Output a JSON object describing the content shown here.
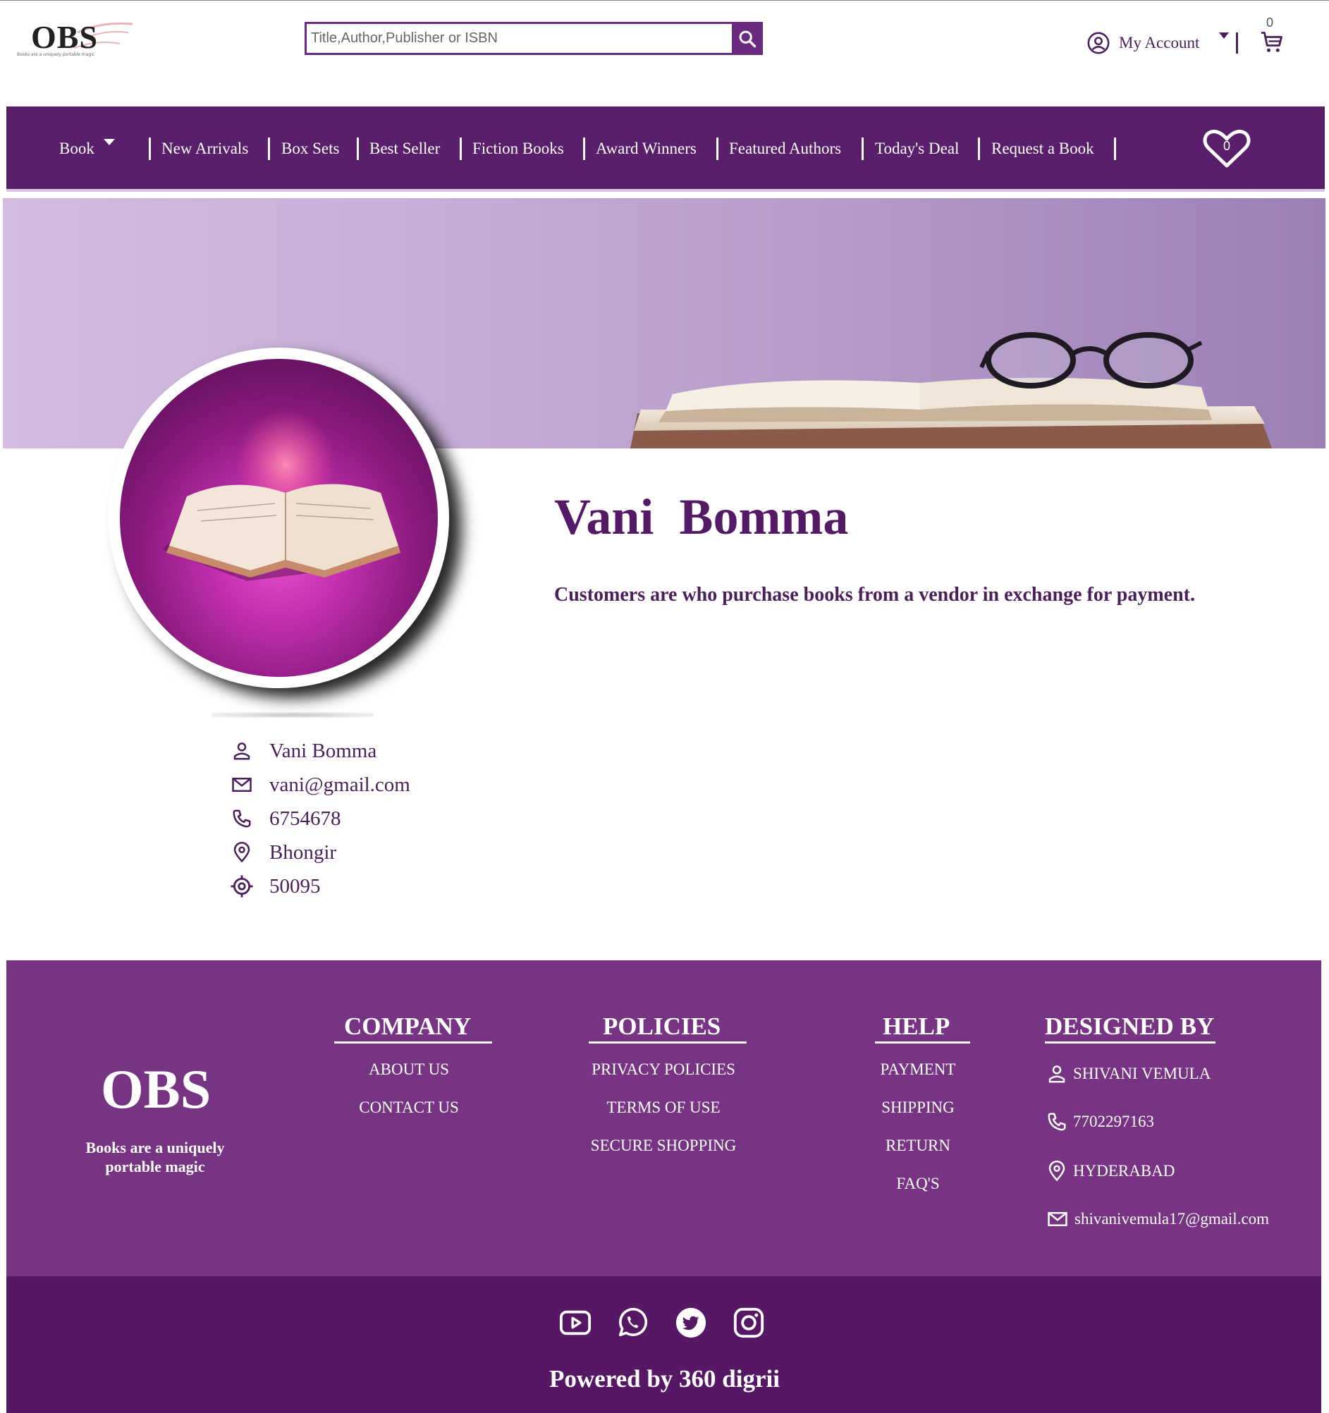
{
  "header": {
    "logo_text": "OBS",
    "logo_tagline": "Books are a uniquely portable magic",
    "search_placeholder": "Title,Author,Publisher or ISBN",
    "account_label": "My Account",
    "cart_count": "0"
  },
  "nav": {
    "items": [
      "Book",
      "New Arrivals",
      "Box Sets",
      "Best Seller",
      "Fiction Books",
      "Award Winners",
      "Featured Authors",
      "Today's Deal",
      "Request a Book"
    ],
    "wishlist_count": "0"
  },
  "profile": {
    "title": "Vani  Bomma",
    "description": "Customers are who purchase books from a vendor in exchange for payment.",
    "details": [
      {
        "icon": "user-icon",
        "text": "Vani Bomma"
      },
      {
        "icon": "mail-icon",
        "text": "vani@gmail.com"
      },
      {
        "icon": "phone-icon",
        "text": "6754678"
      },
      {
        "icon": "location-icon",
        "text": "Bhongir"
      },
      {
        "icon": "target-icon",
        "text": "50095"
      }
    ]
  },
  "footer": {
    "logo_text": "OBS",
    "tagline": "Books are a uniquely portable magic",
    "company": {
      "heading": "COMPANY",
      "links": [
        "ABOUT US",
        "CONTACT US"
      ]
    },
    "policies": {
      "heading": "POLICIES",
      "links": [
        "PRIVACY POLICIES",
        "TERMS OF USE",
        "SECURE SHOPPING"
      ]
    },
    "help": {
      "heading": "HELP",
      "links": [
        "PAYMENT",
        "SHIPPING",
        "RETURN",
        "FAQ'S"
      ]
    },
    "designed_by": {
      "heading": "DESIGNED BY",
      "name": "SHIVANI VEMULA",
      "phone": "7702297163",
      "location": "HYDERABAD",
      "email": "shivanivemula17@gmail.com"
    },
    "social_icons": [
      "youtube-icon",
      "whatsapp-icon",
      "twitter-icon",
      "instagram-icon"
    ],
    "powered_by": "Powered by 360 digrii"
  },
  "colors": {
    "primary": "#5a1f6b",
    "footer": "#773483",
    "footer_bottom": "#561864",
    "text": "#4a1f5c"
  }
}
